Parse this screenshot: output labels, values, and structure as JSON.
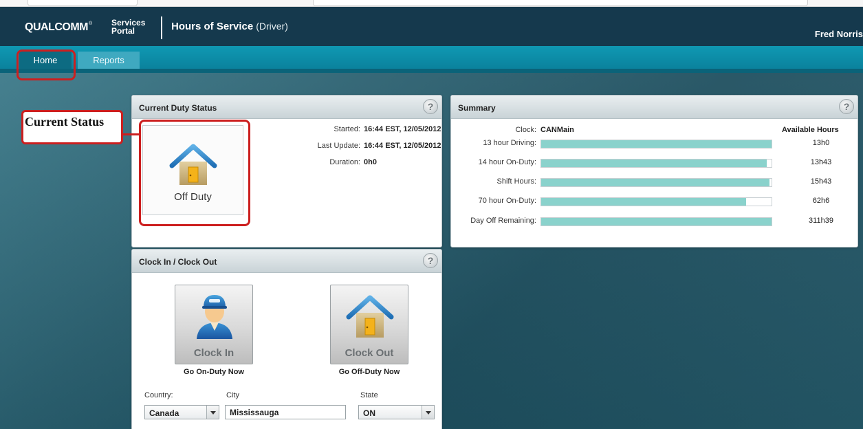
{
  "header": {
    "logo": "QUALCOMM",
    "logo_mark": "®",
    "portal_line1": "Services",
    "portal_line2": "Portal",
    "title": "Hours of Service",
    "subtitle": "(Driver)",
    "user": "Fred Norris"
  },
  "nav": {
    "tabs": [
      {
        "label": "Home",
        "active": true
      },
      {
        "label": "Reports",
        "active": false
      }
    ]
  },
  "annotation": {
    "label": "Current Status",
    "color": "#cc1f1f"
  },
  "duty": {
    "title": "Current Duty Status",
    "help": "?",
    "status": "Off Duty",
    "status_icon": "house-icon",
    "started_label": "Started:",
    "started_value": "16:44 EST, 12/05/2012",
    "last_update_label": "Last Update:",
    "last_update_value": "16:44 EST, 12/05/2012",
    "duration_label": "Duration:",
    "duration_value": "0h0"
  },
  "summary": {
    "title": "Summary",
    "help": "?",
    "clock_label": "Clock:",
    "clock_value": "CANMain",
    "available_header": "Available Hours",
    "bar_color": "#8ad2cc",
    "rows": [
      {
        "label": "13 hour Driving:",
        "hours": "13h0",
        "fraction": 1.0
      },
      {
        "label": "14 hour On-Duty:",
        "hours": "13h43",
        "fraction": 0.98
      },
      {
        "label": "Shift Hours:",
        "hours": "15h43",
        "fraction": 0.99
      },
      {
        "label": "70 hour On-Duty:",
        "hours": "62h6",
        "fraction": 0.89
      },
      {
        "label": "Day Off Remaining:",
        "hours": "311h39",
        "fraction": 1.0
      }
    ]
  },
  "clock": {
    "title": "Clock In / Clock Out",
    "help": "?",
    "clock_in_label": "Clock In",
    "clock_in_sub": "Go On-Duty Now",
    "clock_in_icon": "driver-icon",
    "clock_out_label": "Clock Out",
    "clock_out_sub": "Go Off-Duty Now",
    "clock_out_icon": "house-icon",
    "country_label": "Country:",
    "country_value": "Canada",
    "city_label": "City",
    "city_value": "Mississauga",
    "state_label": "State",
    "state_value": "ON"
  }
}
